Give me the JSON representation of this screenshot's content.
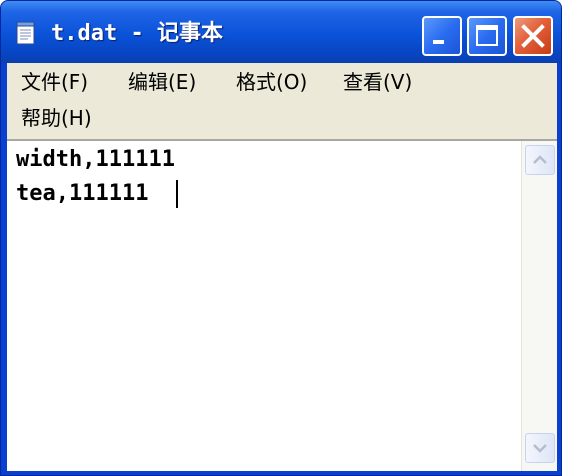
{
  "window": {
    "title": "t.dat - 记事本",
    "icons": [
      "notepad-icon",
      "minimize-icon",
      "maximize-icon",
      "close-icon"
    ]
  },
  "menu": {
    "file": "文件(F)",
    "edit": "编辑(E)",
    "format": "格式(O)",
    "view": "查看(V)",
    "help": "帮助(H)"
  },
  "editor": {
    "lines": [
      "width,111111",
      "tea,111111"
    ]
  },
  "scrollbar": {
    "icons": [
      "scroll-up-arrow-icon",
      "scroll-down-arrow-icon"
    ]
  },
  "colors": {
    "title_bar": "#0a52d8",
    "close_button": "#e2603a",
    "menu_background": "#ece9d8"
  }
}
